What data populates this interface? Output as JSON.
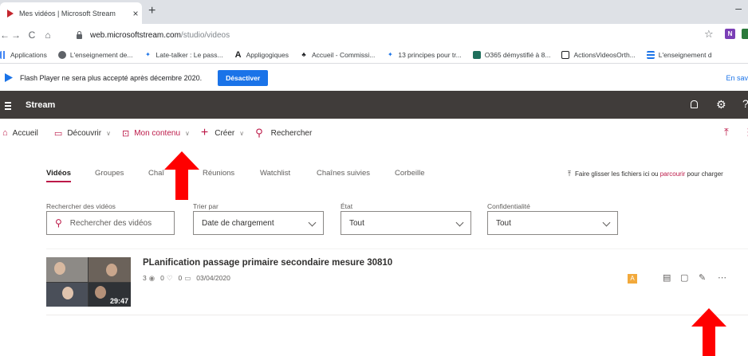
{
  "browser": {
    "tab_title": "Mes vidéos | Microsoft Stream",
    "tab_close": "×",
    "new_tab": "+",
    "url_host": "web.microsoftstream.com",
    "url_path": "/studio/videos",
    "bookmarks": [
      "Applications",
      "L'enseignement de...",
      "Late-talker : Le pass...",
      "Appligogiques",
      "Accueil - Commissi...",
      "13 principes pour tr...",
      "O365 démystifié à 8...",
      "ActionsVideosOrth...",
      "L'enseignement d"
    ]
  },
  "flash": {
    "message": "Flash Player ne sera plus accepté après décembre 2020.",
    "button": "Désactiver",
    "more": "En sav"
  },
  "stream": {
    "app_name": "Stream",
    "nav": {
      "home": "Accueil",
      "discover": "Découvrir",
      "my_content": "Mon contenu",
      "create": "Créer",
      "search": "Rechercher"
    },
    "tabs": [
      "Vidéos",
      "Groupes",
      "Chaî",
      "Réunions",
      "Watchlist",
      "Chaînes suivies",
      "Corbeille"
    ],
    "drop_hint": {
      "before": "Faire glisser les fichiers ici ou ",
      "link": "parcourir",
      "after": " pour charger"
    },
    "filters": {
      "search_label": "Rechercher des vidéos",
      "search_placeholder": "Rechercher des vidéos",
      "sort_label": "Trier par",
      "sort_value": "Date de chargement",
      "state_label": "État",
      "state_value": "Tout",
      "privacy_label": "Confidentialité",
      "privacy_value": "Tout"
    },
    "video": {
      "title": "PLanification passage primaire secondaire mesure 30810",
      "views": "3",
      "likes": "0",
      "comments": "0",
      "date": "03/04/2020",
      "duration": "29:47"
    }
  },
  "colors": {
    "accent": "#bc1948",
    "header_bg": "#403c3a",
    "arrow": "#ff0000",
    "chrome_blue": "#1a73e8"
  }
}
